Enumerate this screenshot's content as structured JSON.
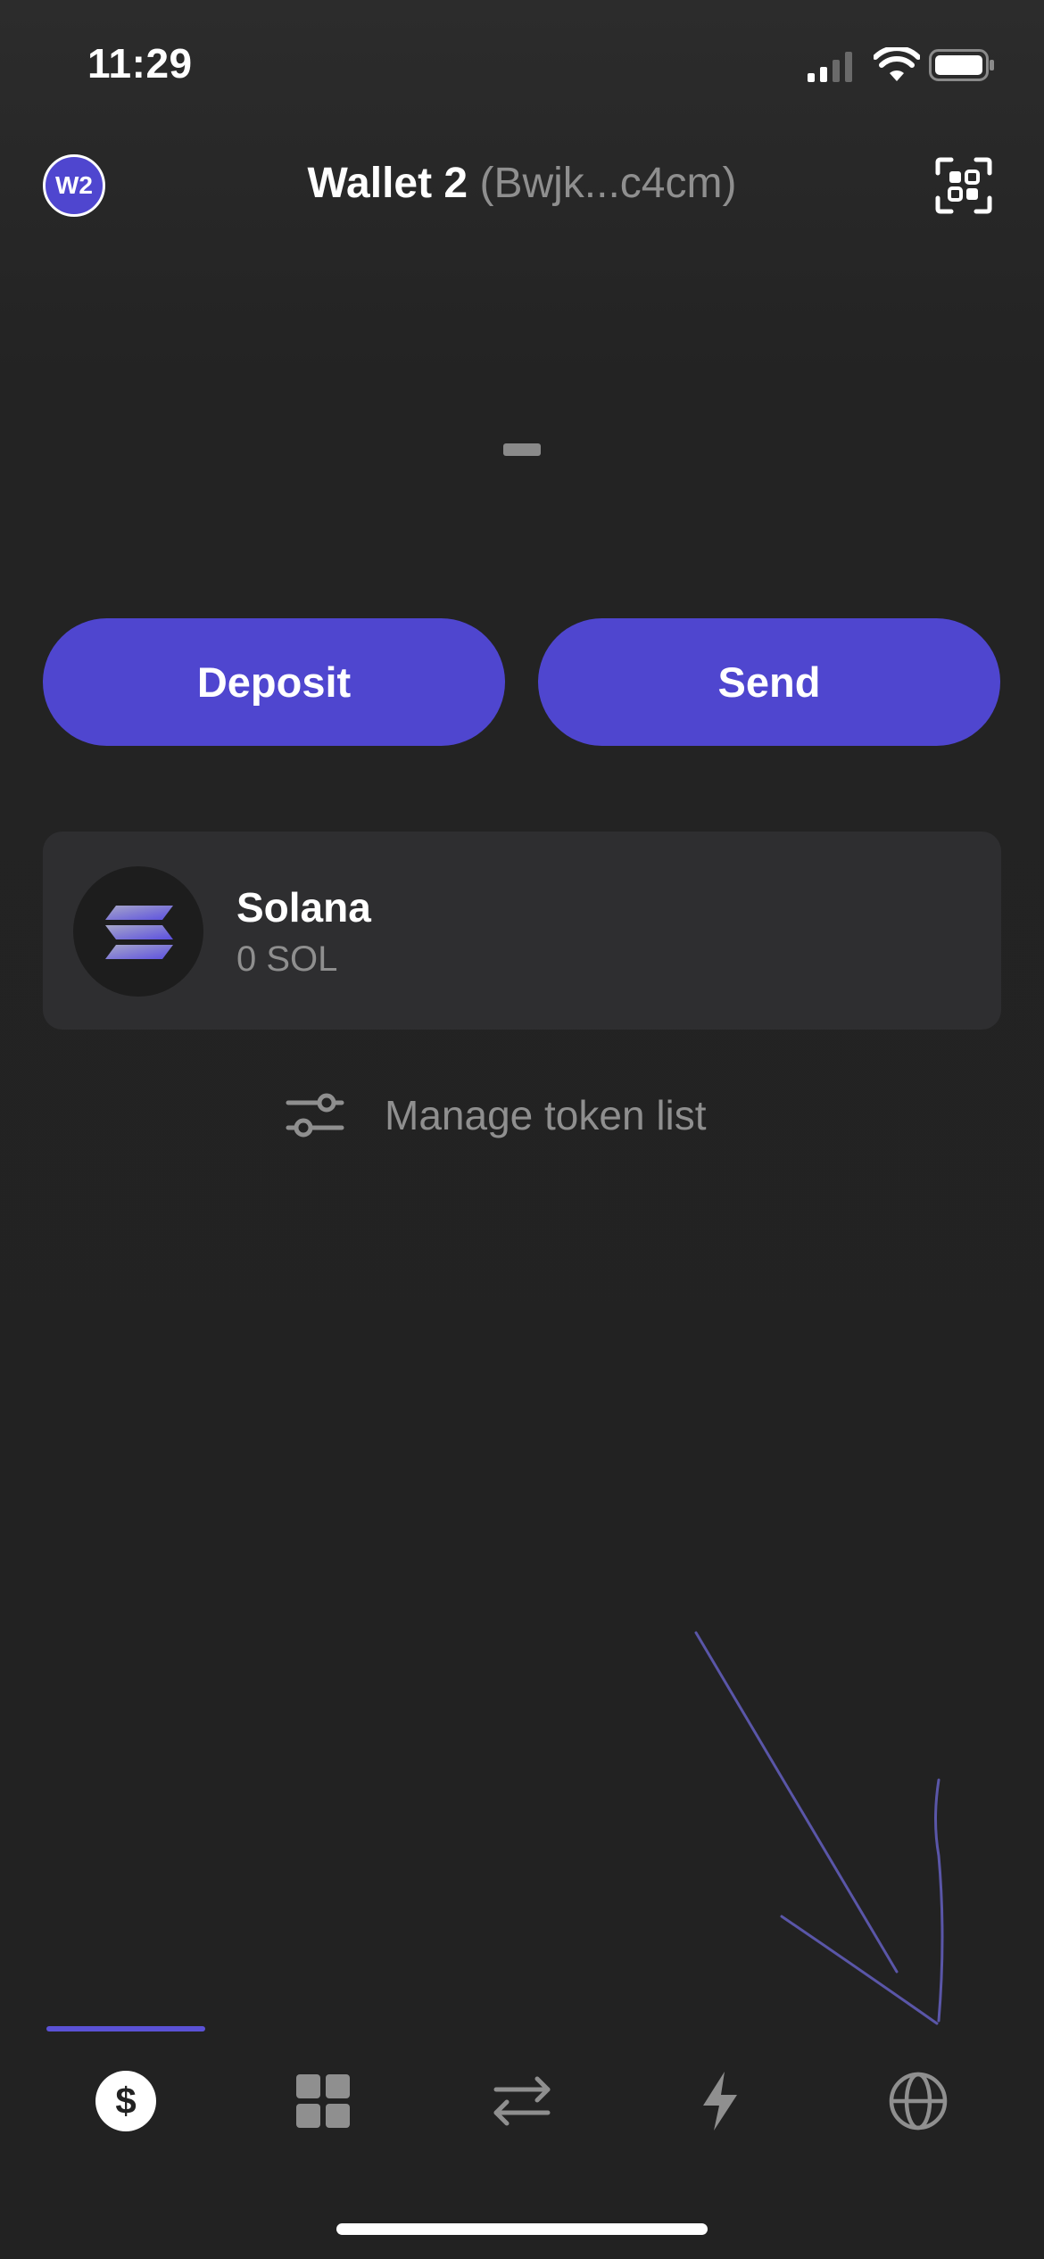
{
  "status_bar": {
    "time": "11:29"
  },
  "header": {
    "avatar_initials": "W2",
    "wallet_name": "Wallet 2",
    "wallet_address": "(Bwjk...c4cm)"
  },
  "actions": {
    "deposit_label": "Deposit",
    "send_label": "Send"
  },
  "tokens": [
    {
      "name": "Solana",
      "balance": "0 SOL",
      "icon": "solana-logo-icon"
    }
  ],
  "manage_token_list_label": "Manage token list",
  "tab_bar": {
    "active": "tokens",
    "tabs": [
      {
        "id": "tokens",
        "icon": "dollar-icon"
      },
      {
        "id": "collectibles",
        "icon": "grid-icon"
      },
      {
        "id": "swap",
        "icon": "swap-arrows-icon"
      },
      {
        "id": "activity",
        "icon": "lightning-icon"
      },
      {
        "id": "browser",
        "icon": "globe-icon"
      }
    ]
  },
  "colors": {
    "accent": "#4f46cf",
    "background": "#222222",
    "card": "#2e2e30",
    "muted_text": "#8f8f8f",
    "annotation_stroke": "#5a56a8"
  }
}
